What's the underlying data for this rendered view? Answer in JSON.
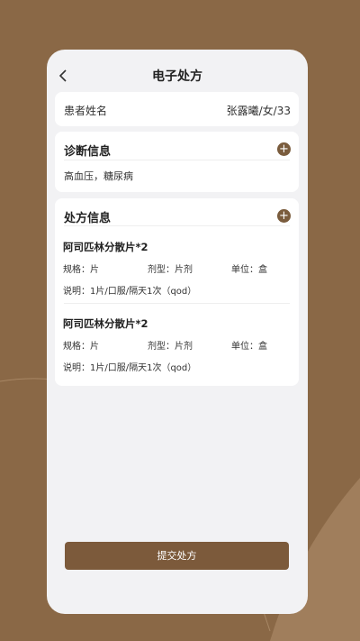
{
  "header": {
    "title": "电子处方",
    "back_icon": "chevron-left-icon"
  },
  "patient": {
    "label": "患者姓名",
    "value": "张露曦/女/33"
  },
  "diagnosis": {
    "title": "诊断信息",
    "text": "高血压，糖尿病",
    "add_icon": "plus-circle-icon"
  },
  "prescription": {
    "title": "处方信息",
    "add_icon": "plus-circle-icon",
    "items": [
      {
        "name": "阿司匹林分散片*2",
        "spec": "规格：片",
        "form": "剂型：片剂",
        "unit": "单位：盒",
        "usage": "说明：1片/口服/隔天1次（qod）"
      },
      {
        "name": "阿司匹林分散片*2",
        "spec": "规格：片",
        "form": "剂型：片剂",
        "unit": "单位：盒",
        "usage": "说明：1片/口服/隔天1次（qod）"
      }
    ]
  },
  "submit_label": "提交处方",
  "colors": {
    "background": "#8a6846",
    "accent": "#7c5a3b",
    "card": "#ffffff",
    "panel": "#f2f2f4"
  }
}
